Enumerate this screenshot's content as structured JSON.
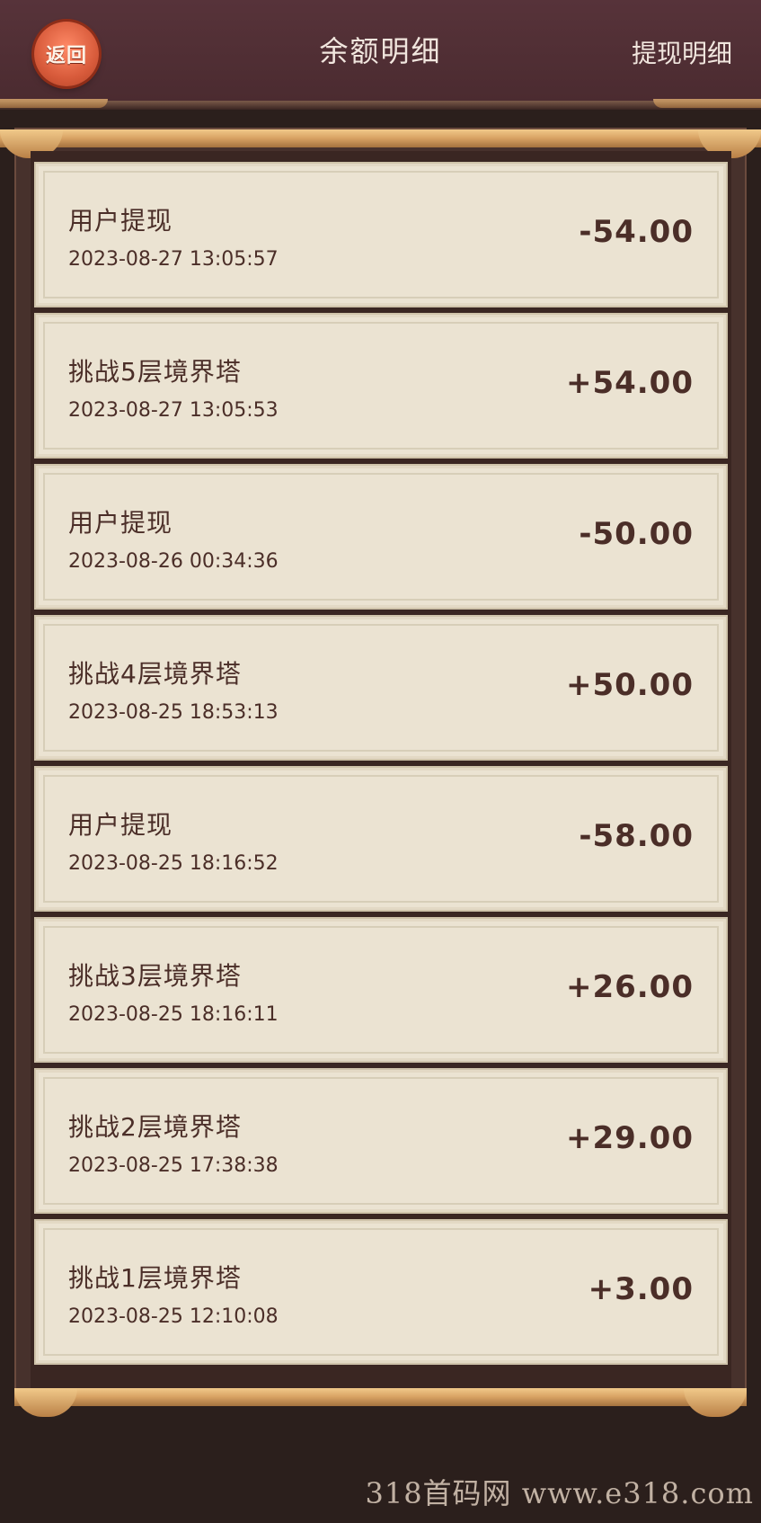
{
  "header": {
    "back_label": "返回",
    "title": "余额明细",
    "withdraw_details_label": "提现明细"
  },
  "records": [
    {
      "title": "用户提现",
      "time": "2023-08-27 13:05:57",
      "amount": "-54.00"
    },
    {
      "title": "挑战5层境界塔",
      "time": "2023-08-27 13:05:53",
      "amount": "+54.00"
    },
    {
      "title": "用户提现",
      "time": "2023-08-26 00:34:36",
      "amount": "-50.00"
    },
    {
      "title": "挑战4层境界塔",
      "time": "2023-08-25 18:53:13",
      "amount": "+50.00"
    },
    {
      "title": "用户提现",
      "time": "2023-08-25 18:16:52",
      "amount": "-58.00"
    },
    {
      "title": "挑战3层境界塔",
      "time": "2023-08-25 18:16:11",
      "amount": "+26.00"
    },
    {
      "title": "挑战2层境界塔",
      "time": "2023-08-25 17:38:38",
      "amount": "+29.00"
    },
    {
      "title": "挑战1层境界塔",
      "time": "2023-08-25 12:10:08",
      "amount": "+3.00"
    }
  ],
  "watermark": {
    "text": "318首码网  www.e318.com"
  },
  "colors": {
    "header_bg": "#4b2b30",
    "card_bg": "#ebe3d2",
    "text_dark": "#4b2e28",
    "accent_gold": "#d7a162",
    "back_button": "#d85b3b"
  }
}
